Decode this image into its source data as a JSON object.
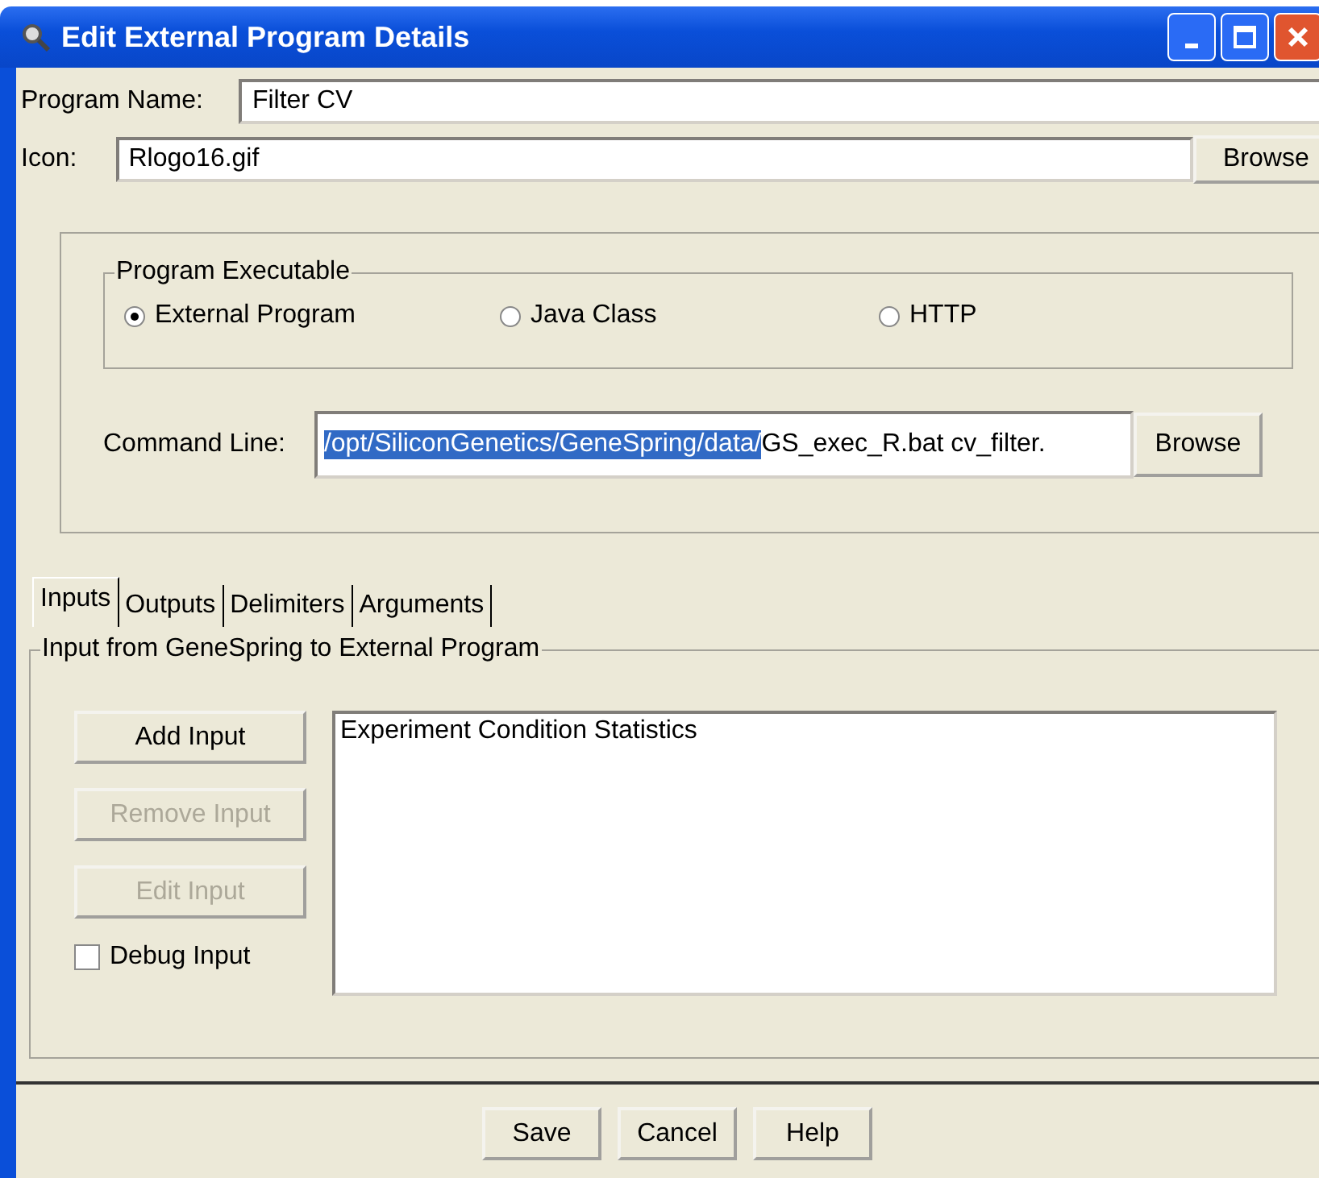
{
  "window": {
    "title": "Edit External Program Details"
  },
  "program_name": {
    "label": "Program Name:",
    "value": "Filter CV"
  },
  "icon_field": {
    "label": "Icon:",
    "value": "Rlogo16.gif",
    "button": "Browse"
  },
  "program_executable": {
    "title": "Program Executable",
    "options": [
      {
        "label": "External Program",
        "selected": true
      },
      {
        "label": "Java Class",
        "selected": false
      },
      {
        "label": "HTTP",
        "selected": false
      }
    ]
  },
  "command_line": {
    "label": "Command Line:",
    "value_parts": [
      {
        "text": "/opt/SiliconGenetics/GeneSpring/data/",
        "selected": true
      },
      {
        "text": "GS_exec_R.bat cv_filter.",
        "selected": false
      }
    ],
    "button": "Browse"
  },
  "tabs": [
    {
      "label": "Inputs",
      "selected": true
    },
    {
      "label": "Outputs",
      "selected": false
    },
    {
      "label": "Delimiters",
      "selected": false
    },
    {
      "label": "Arguments",
      "selected": false
    }
  ],
  "inputs_group": {
    "title": "Input from GeneSpring to External Program",
    "buttons": [
      {
        "label": "Add Input",
        "disabled": false
      },
      {
        "label": "Remove Input",
        "disabled": true
      },
      {
        "label": "Edit Input",
        "disabled": true
      }
    ],
    "debug": {
      "label": "Debug Input",
      "checked": false
    },
    "list_items": [
      "Experiment Condition Statistics"
    ]
  },
  "buttons": [
    "Save",
    "Cancel",
    "Help"
  ]
}
